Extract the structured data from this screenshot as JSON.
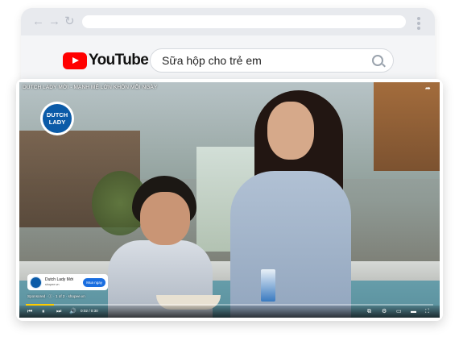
{
  "browser": {
    "nav": {
      "back": "←",
      "forward": "→",
      "reload": "↻"
    },
    "url": ""
  },
  "youtube": {
    "logo_text": "YouTube",
    "search_query": "Sữa hộp cho trẻ em"
  },
  "video": {
    "title": "DUTCH LADY MỚI - MẠNH MẼ LỚN KHÔN MỖI NGÀY",
    "brand": {
      "line1": "DUTCH",
      "line2": "LADY"
    },
    "ad": {
      "name": "Dutch Lady Mới",
      "domain": "shopee.vn",
      "cta": "Mua ngay",
      "sponsored": "Sponsored · ⓘ · 1 of 2 · shopee.vn"
    },
    "time": "0:02 / 0:30",
    "progress": 0.07
  },
  "icons": [
    "search-icon",
    "share-icon",
    "prev-icon",
    "pause-icon",
    "next-icon",
    "volume-icon",
    "captions-icon",
    "settings-icon",
    "miniplayer-icon",
    "theater-icon",
    "fullscreen-icon"
  ],
  "colors": {
    "youtube_red": "#ff0000",
    "ad_button": "#1a6ee0",
    "progress": "#ffcc00"
  }
}
